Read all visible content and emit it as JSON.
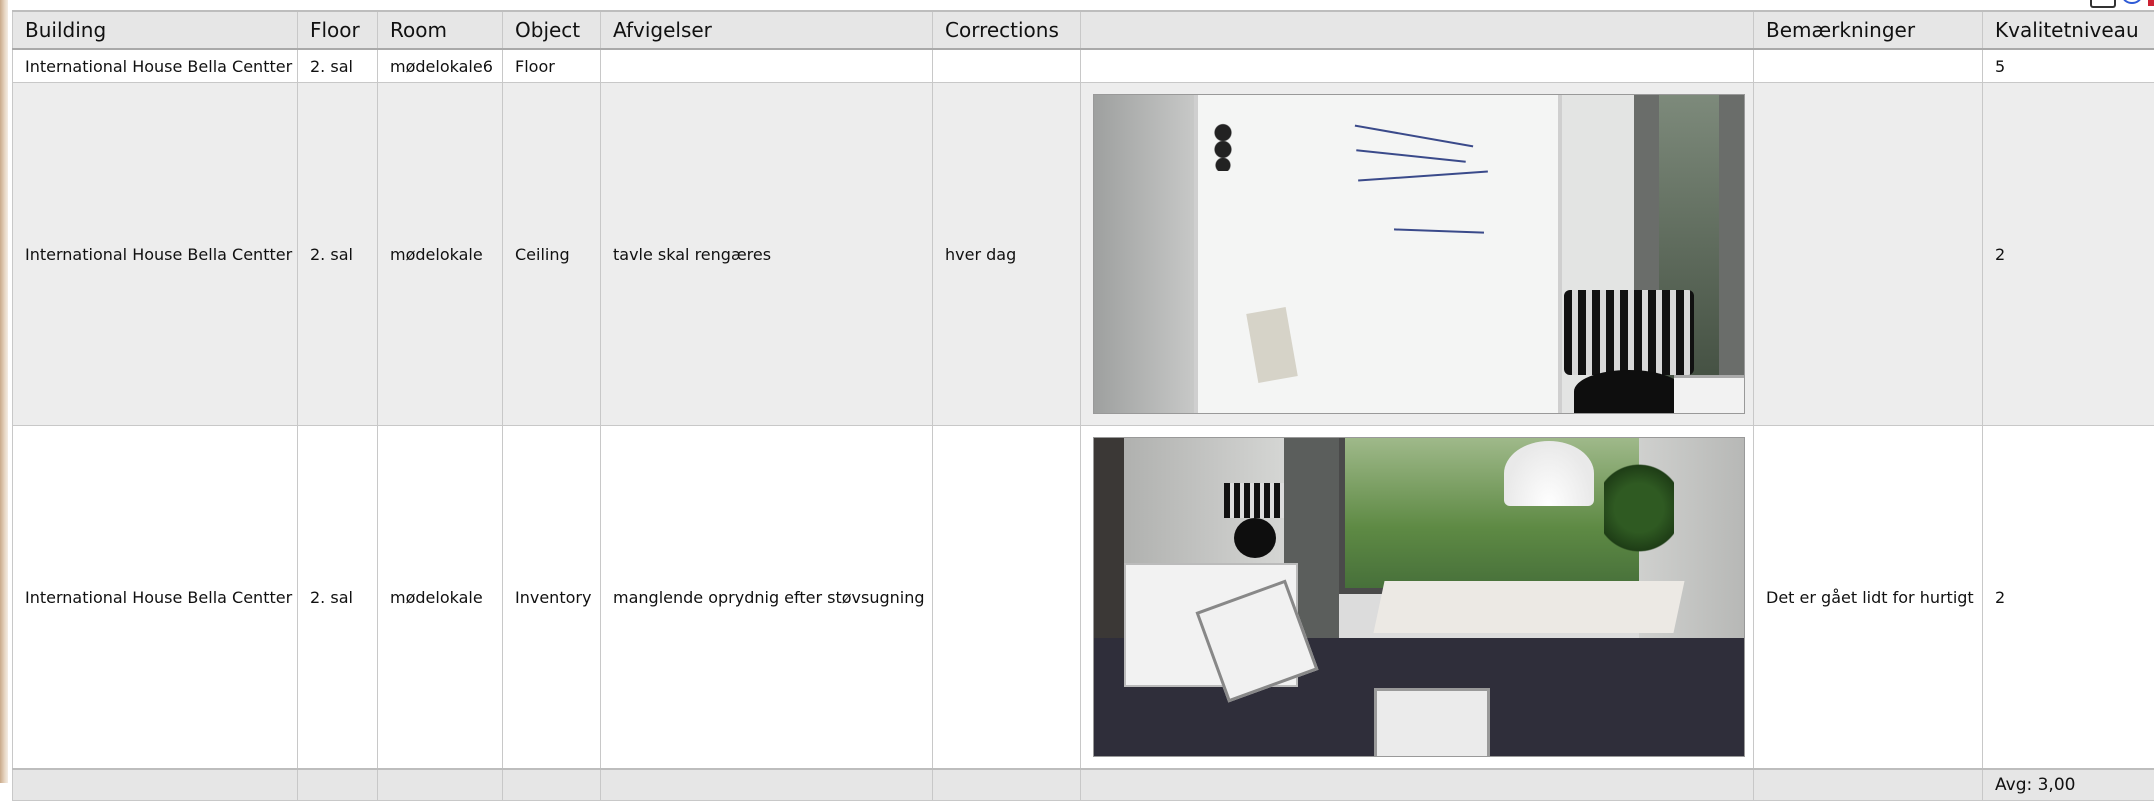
{
  "table": {
    "headers": [
      "Building",
      "Floor",
      "Room",
      "Object",
      "Afvigelser",
      "Corrections",
      "",
      "Bemærkninger",
      "Kvalitetniveau"
    ],
    "rows": [
      {
        "building": "International House Bella Centter",
        "floor": "2. sal",
        "room": "mødelokale6",
        "object": "Floor",
        "afvigelser": "",
        "corrections": "",
        "bemaerkninger": "",
        "kvalitetniveau": "5"
      },
      {
        "building": "International House Bella Centter",
        "floor": "2. sal",
        "room": "mødelokale",
        "object": "Ceiling",
        "afvigelser": "tavle skal rengæres",
        "corrections": "hver dag",
        "bemaerkninger": "",
        "kvalitetniveau": "2"
      },
      {
        "building": "International House Bella Centter",
        "floor": "2. sal",
        "room": "mødelokale",
        "object": "Inventory",
        "afvigelser": "manglende oprydnig efter støvsugning",
        "corrections": "",
        "bemaerkninger": "Det er gået lidt for hurtigt",
        "kvalitetniveau": "2"
      }
    ],
    "footer": {
      "avg": "Avg: 3,00"
    }
  },
  "toolbar": {
    "icons": [
      "printer-icon",
      "refresh-icon",
      "export-icon"
    ]
  }
}
